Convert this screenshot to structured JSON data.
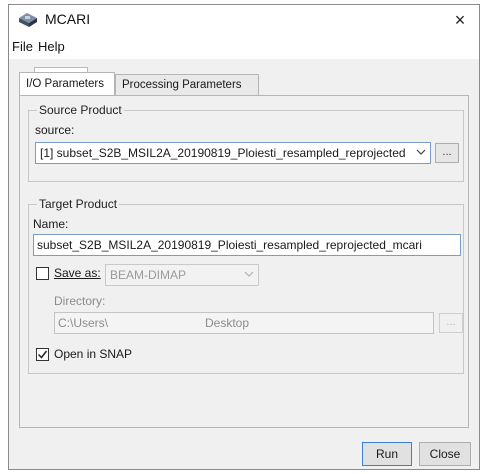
{
  "window": {
    "title": "MCARI",
    "close_glyph": "×"
  },
  "menu": {
    "file": "File",
    "help": "Help"
  },
  "tabs": {
    "io": "I/O Parameters",
    "processing": "Processing Parameters"
  },
  "source_product": {
    "group_title": "Source Product",
    "source_label": "source:",
    "source_value": "[1] subset_S2B_MSIL2A_20190819_Ploiesti_resampled_reprojected",
    "browse_label": "..."
  },
  "target_product": {
    "group_title": "Target Product",
    "name_label": "Name:",
    "name_value": "subset_S2B_MSIL2A_20190819_Ploiesti_resampled_reprojected_mcari",
    "save_as_label": "Save as:",
    "save_as_checked": false,
    "format_value": "BEAM-DIMAP",
    "directory_label": "Directory:",
    "directory_value": "C:\\Users\\",
    "directory_suffix": "Desktop",
    "browse_label": "...",
    "open_in_snap_label": "Open in SNAP",
    "open_in_snap_checked": true
  },
  "buttons": {
    "run": "Run",
    "close": "Close"
  },
  "icons": {
    "app": "satellite-layers-icon",
    "dropdown": "chevron-down-icon",
    "check": "checkmark-icon"
  },
  "colors": {
    "focus_border": "#3c7fd0",
    "panel_bg": "#f0f0f0"
  }
}
